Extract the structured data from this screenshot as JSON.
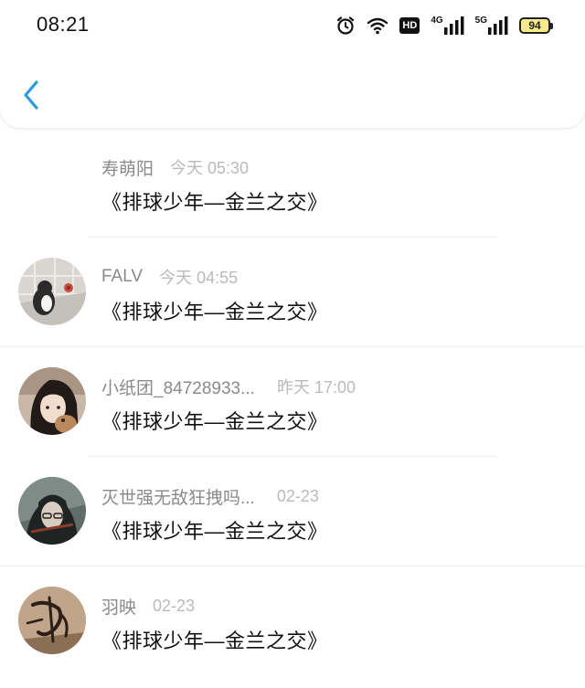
{
  "status_bar": {
    "time": "08:21",
    "hd_label": "HD",
    "net1_label": "4G",
    "net2_label": "5G",
    "battery": "94",
    "icons": [
      "alarm-icon",
      "wifi-icon",
      "hd-icon",
      "signal-4g-icon",
      "signal-5g-icon",
      "battery-icon"
    ]
  },
  "nav": {
    "back_icon": "chevron-left-icon",
    "accent_color": "#2a9be0"
  },
  "comments": [
    {
      "name": "寿萌阳",
      "time": "今天 05:30",
      "message": "《排球少年—金兰之交》",
      "avatar": "none"
    },
    {
      "name": "FALV",
      "time": "今天 04:55",
      "message": "《排球少年—金兰之交》",
      "avatar": "penguin-photo"
    },
    {
      "name": "小纸团_84728933...",
      "time": "昨天 17:00",
      "message": "《排球少年—金兰之交》",
      "avatar": "girl-photo"
    },
    {
      "name": "灭世强无敌狂拽吗...",
      "time": "02-23",
      "message": "《排球少年—金兰之交》",
      "avatar": "anime-photo"
    },
    {
      "name": "羽映",
      "time": "02-23",
      "message": "《排球少年—金兰之交》",
      "avatar": "calligraphy-photo"
    }
  ]
}
